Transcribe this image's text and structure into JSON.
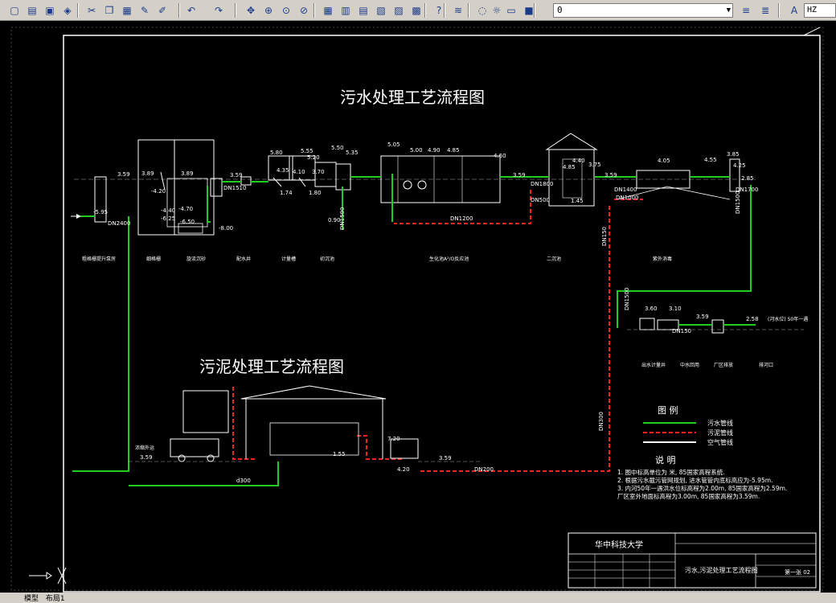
{
  "toolbar": {
    "layer_value": "0",
    "text_style": "HZ",
    "icons": [
      "new-icon",
      "open-icon",
      "save-icon",
      "plot-icon",
      "cut-icon",
      "copy-icon",
      "paste-icon",
      "match-prop-icon",
      "brush-icon",
      "undo-icon",
      "redo-icon",
      "pan-icon",
      "zoom-realtime-icon",
      "zoom-window-icon",
      "zoom-previous-icon",
      "properties-icon",
      "design-center-icon",
      "tool-palette-icon",
      "sheet-set-icon",
      "markup-icon",
      "calculator-icon",
      "help-icon",
      "layer-manager-icon",
      "bulb-icon",
      "sun-icon",
      "lock-icon",
      "color-icon",
      "layer-prev-icon",
      "layer-state-icon",
      "text-style-icon"
    ]
  },
  "drawing": {
    "title_sewage": "污水处理工艺流程图",
    "title_sludge": "污泥处理工艺流程图",
    "legend_title": "图 例",
    "legend_items": [
      {
        "label": "污水管线",
        "color": "#22cc22"
      },
      {
        "label": "污泥管线",
        "color": "#ff2020"
      },
      {
        "label": "空气管线",
        "color": "#ffffff"
      }
    ],
    "notes_title": "说 明",
    "notes": [
      "1. 图中标高单位为 米, 85国家高程系统.",
      "2. 根据污水截污管网规划, 进水管管内底标高应为-5.95m.",
      "3. 内河50年一遇洪水位标高程为2.00m, 85国家高程为2.59m.",
      "   厂区室外地面标高程为3.00m, 85国家高程为3.59m."
    ],
    "school": "华中科技大学",
    "sheet_name": "污水,污泥处理工艺流程图",
    "sheet_no": "第一张 02",
    "pipe_labels": [
      "DN2400",
      "DN1500",
      "DN1510",
      "DN1200",
      "DN1800",
      "DN1000",
      "DN1400",
      "DN150",
      "DN500",
      "DN1500",
      "DN200",
      "DN300",
      "d300",
      "DN1500",
      "DN150",
      "DN1700"
    ],
    "elevations": [
      "3.59",
      "3.89",
      "3.89",
      "5.80",
      "5.55",
      "5.20",
      "5.50",
      "5.35",
      "5.05",
      "5.00",
      "4.90",
      "4.85",
      "4.60",
      "4.40",
      "4.85",
      "3.75",
      "4.05",
      "4.55",
      "3.85",
      "4.25",
      "3.59",
      "2.85",
      "3.59",
      "-5.95",
      "-4.20",
      "-4.40",
      "-4.70",
      "-6.25",
      "-6.50",
      "-8.00",
      "4.35",
      "4.10",
      "3.70",
      "3.59",
      "1.74",
      "1.80",
      "0.90",
      "1.45",
      "3.60",
      "3.10",
      "3.59",
      "2.58",
      "7.20",
      "4.20",
      "3.59",
      "3.59",
      "1.55"
    ],
    "river_note": "(河水位) 50年一遇",
    "unit_labels": [
      "粗格栅提升泵房",
      "细格栅",
      "旋流沉砂",
      "配水井",
      "计量槽",
      "初沉池",
      "生化池A²/O反应池",
      "二沉池",
      "紫外消毒",
      "出水计量井",
      "中水回用",
      "厂区排放",
      "排河口"
    ],
    "sludge_label": "浓缩外运"
  },
  "status": {
    "tab_model": "模型",
    "tab_layout": "布局1"
  }
}
